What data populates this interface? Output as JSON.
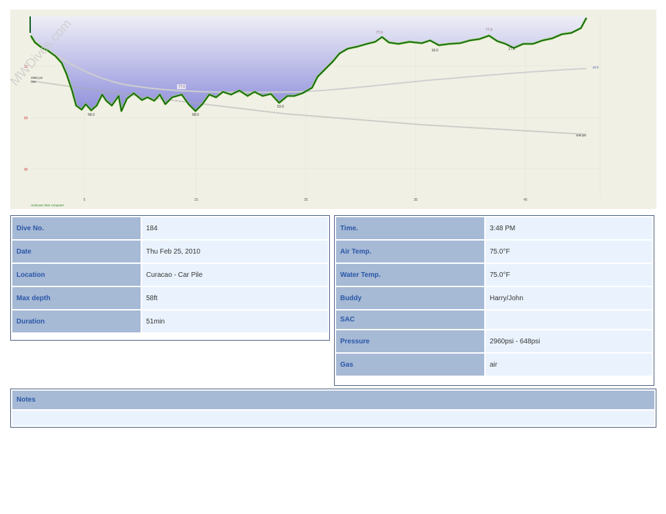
{
  "watermark": "MWDives.com",
  "chart_data": {
    "type": "line",
    "x_ticks": [
      "5",
      "15",
      "25",
      "35",
      "45"
    ],
    "y_ticks": [
      "30",
      "60",
      "90"
    ],
    "depth_labels": [
      "58.0",
      "58.0",
      "53.0",
      "18.0",
      "18.0",
      "17.0"
    ],
    "temp_labels": [
      "77.0",
      "77.0",
      "77.0"
    ],
    "start_pressure": "2960 psi",
    "gas": "AIR",
    "end_pressure": "648 psi",
    "end_rate": "30 ft",
    "computer": "Unknown dive computer",
    "colors": {
      "background": "#f1f0e5",
      "fill_top": "#eeeef6",
      "fill_bottom": "#8f8fdc",
      "profile_light": "#7ec83a",
      "profile_dark": "#0f5c1e",
      "pressure": "#a8a8a8",
      "tick": "#cc3333"
    }
  },
  "dive": {
    "number_label": "Dive No.",
    "number": "184",
    "date_label": "Date",
    "date": "Thu Feb 25, 2010",
    "location_label": "Location",
    "location": "Curacao - Car Pile",
    "max_depth_label": "Max depth",
    "max_depth": "58ft",
    "duration_label": "Duration",
    "duration": "51min"
  },
  "conditions": {
    "time_label": "Time.",
    "time": "3:48 PM",
    "air_temp_label": "Air Temp.",
    "air_temp": "75.0°F",
    "water_temp_label": "Water Temp.",
    "water_temp": "75.0°F",
    "buddy_label": "Buddy",
    "buddy": "Harry/John",
    "sac_label": "SAC",
    "sac": "",
    "pressure_label": "Pressure",
    "pressure": "2960psi - 648psi",
    "gas_label": "Gas",
    "gas": "air"
  },
  "notes": {
    "label": "Notes",
    "text": ""
  }
}
